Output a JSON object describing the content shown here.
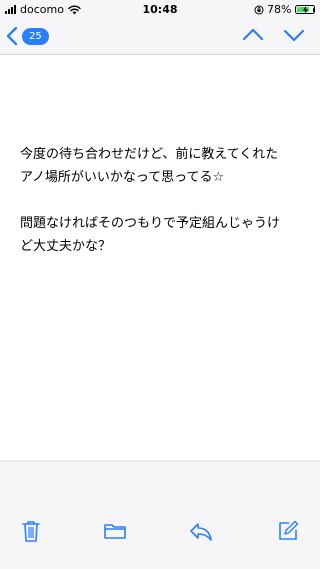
{
  "status_bar": {
    "carrier": "docomo",
    "time": "10:48",
    "battery_percent": "78%",
    "battery_level": 0.78,
    "icons": [
      "signal-icon",
      "wifi-icon",
      "orientation-lock-icon",
      "battery-icon",
      "charging-icon"
    ]
  },
  "nav": {
    "back_badge": "25",
    "icons": [
      "back-chevron-icon",
      "chevron-up-icon",
      "chevron-down-icon"
    ]
  },
  "message": {
    "paragraph_1": "今度の待ち合わせだけど、前に教えてくれた\nアノ場所がいいかなって思ってる☆",
    "paragraph_2": "問題なければそのつもりで予定組んじゃうけ\nど大丈夫かな？"
  },
  "toolbar": {
    "icons": [
      "trash-icon",
      "folder-icon",
      "reply-icon",
      "compose-icon"
    ]
  },
  "colors": {
    "accent": "#2a7fff",
    "background": "#f6f6f8",
    "battery_fill": "#4cd964"
  }
}
